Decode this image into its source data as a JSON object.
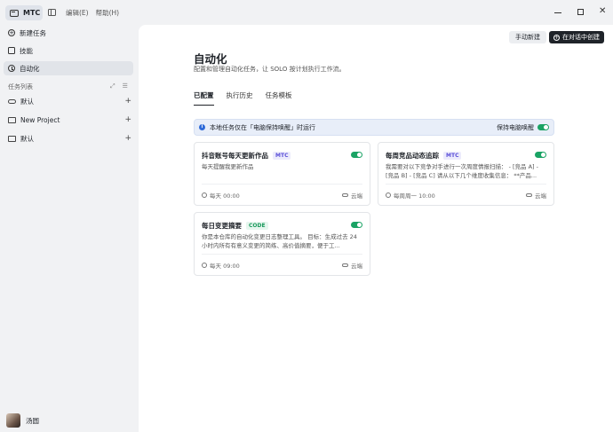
{
  "titlebar": {
    "app_name": "MTC",
    "menu": [
      "编辑(E)",
      "帮助(H)"
    ]
  },
  "sidebar": {
    "nav": [
      {
        "label": "新建任务",
        "icon": "plus-circle-icon"
      },
      {
        "label": "技能",
        "icon": "skill-icon"
      },
      {
        "label": "自动化",
        "icon": "clock-icon",
        "active": true
      }
    ],
    "section_label": "任务列表",
    "folders": [
      {
        "label": "默认",
        "icon": "cloud-icon"
      },
      {
        "label": "New Project",
        "icon": "folder-icon"
      },
      {
        "label": "默认",
        "icon": "folder-icon"
      }
    ],
    "user_name": "汤圆"
  },
  "main": {
    "manual_button": "手动新建",
    "chat_button": "在对话中创建",
    "title": "自动化",
    "subtitle": "配置和管理自动化任务，让 SOLO 按计划执行工作流。",
    "tabs": [
      "已配置",
      "执行历史",
      "任务模板"
    ],
    "info_text": "本地任务仅在「电脑保持唤醒」时运行",
    "keep_awake_label": "保持电脑唤醒",
    "keep_awake_on": true,
    "cards": [
      {
        "title": "抖音账号每天更新作品",
        "badge": "MTC",
        "desc": "每天提醒我更新作品",
        "schedule": "每天 00:00",
        "location": "云端",
        "enabled": true
      },
      {
        "title": "每周竞品动态追踪",
        "badge": "MTC",
        "desc": "我需要对以下竞争对手进行一次周度情报扫描： - [竞品 A] - [竞品 B] - [竞品 C] 请从以下几个维度收集信息： **产品...",
        "schedule": "每周周一 10:00",
        "location": "云端",
        "enabled": true
      },
      {
        "title": "每日变更摘要",
        "badge": "CODE",
        "desc": "你是本仓库的自动化变更日志整理工具。 目标：生成过去 24 小时内所有有意义变更的简练、高价值摘要，便于工...",
        "schedule": "每天 09:00",
        "location": "云端",
        "enabled": true
      }
    ]
  },
  "colors": {
    "toggle_on": "#1aa364",
    "accent_dark": "#1f2329",
    "info_bg": "#e8eef9"
  }
}
